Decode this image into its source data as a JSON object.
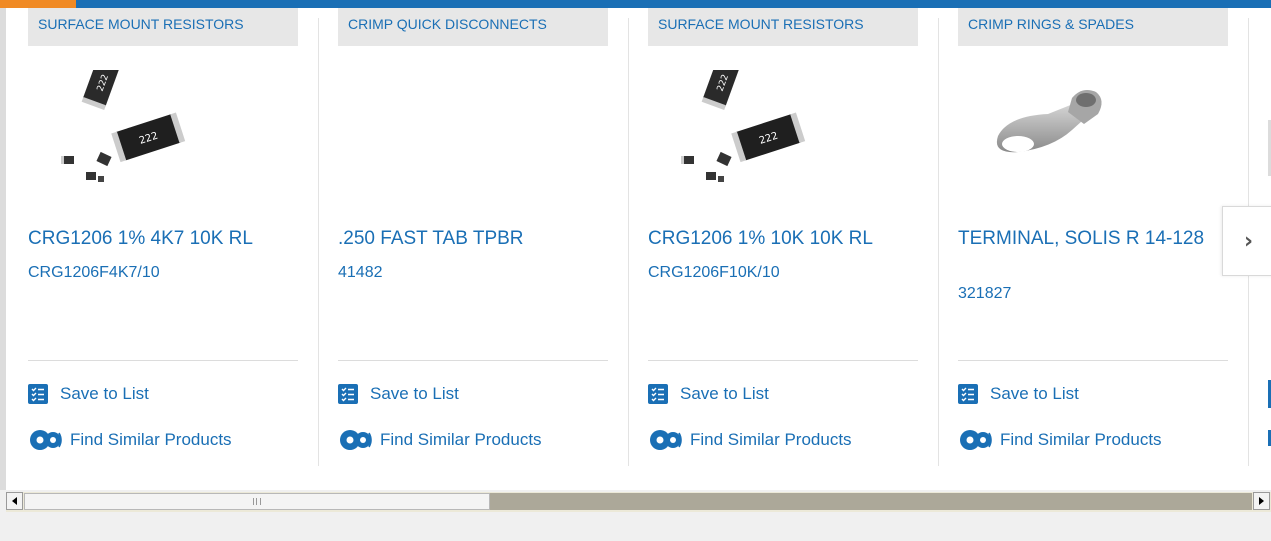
{
  "carousel": {
    "products": [
      {
        "category": "SURFACE MOUNT RESISTORS",
        "title": "CRG1206 1% 4K7 10K RL",
        "sku": "CRG1206F4K7/10",
        "image": "smd-resistor-image"
      },
      {
        "category": "CRIMP QUICK DISCONNECTS",
        "title": ".250 FAST TAB TPBR",
        "sku": "41482",
        "image": ""
      },
      {
        "category": "SURFACE MOUNT RESISTORS",
        "title": "CRG1206 1% 10K 10K RL",
        "sku": "CRG1206F10K/10",
        "image": "smd-resistor-image"
      },
      {
        "category": "CRIMP RINGS & SPADES",
        "title": "TERMINAL, SOLIS R 14-128",
        "sku": "321827",
        "image": "ring-terminal-image"
      }
    ],
    "actions": {
      "save_label": "Save to List",
      "similar_label": "Find Similar Products"
    },
    "next_icon": "chevron-right-icon"
  },
  "colors": {
    "accent": "#f08a24",
    "brand_blue": "#1a6fb5",
    "category_bg": "#e7e7e7"
  }
}
